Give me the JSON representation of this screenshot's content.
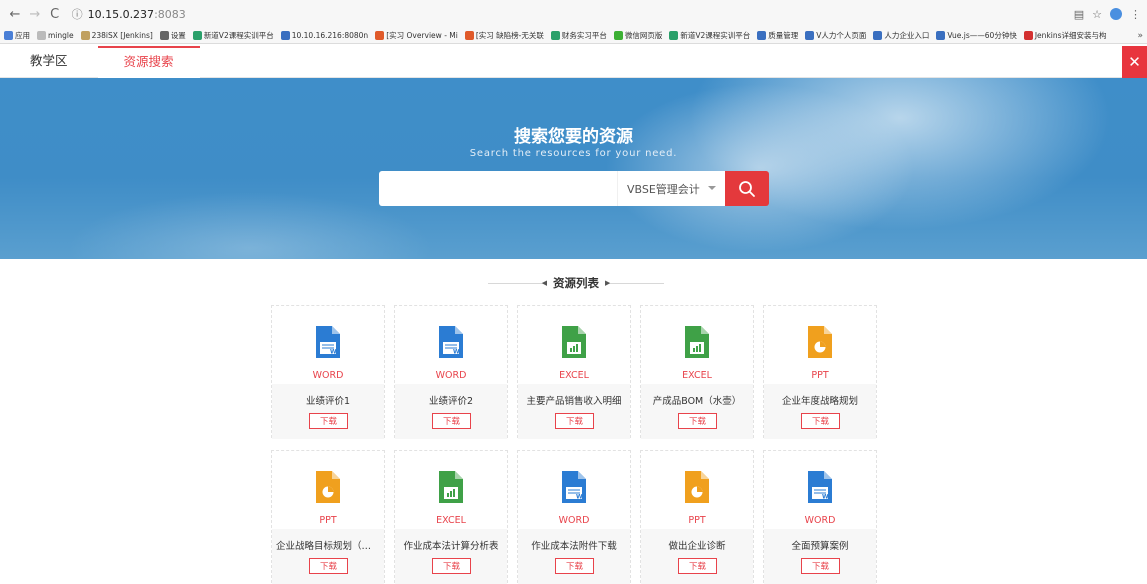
{
  "browser": {
    "url_host": "10.15.0.237",
    "url_port": ":8083",
    "bookmarks": [
      {
        "label": "应用",
        "color": "#4a7fd6"
      },
      {
        "label": "mingle",
        "color": "#bbbbbb"
      },
      {
        "label": "238iSX [Jenkins]",
        "color": "#c0a060"
      },
      {
        "label": "设置",
        "color": "#666666"
      },
      {
        "label": "新道V2课程实训平台",
        "color": "#2aa06a"
      },
      {
        "label": "10.10.16.216:8080n",
        "color": "#3a6fc0"
      },
      {
        "label": "[实习 Overview - Mi",
        "color": "#e05a2a"
      },
      {
        "label": "[实习 缺陷榜-无关联",
        "color": "#e05a2a"
      },
      {
        "label": "财务实习平台",
        "color": "#2aa06a"
      },
      {
        "label": "微信网页版",
        "color": "#3cb034"
      },
      {
        "label": "新道V2课程实训平台",
        "color": "#2aa06a"
      },
      {
        "label": "质量管理",
        "color": "#3a6fc0"
      },
      {
        "label": "V人力个人页面",
        "color": "#3a6fc0"
      },
      {
        "label": "人力企业入口",
        "color": "#3a6fc0"
      },
      {
        "label": "Vue.js——60分钟快",
        "color": "#3a6fc0"
      },
      {
        "label": "Jenkins详细安装与构",
        "color": "#d33030"
      }
    ],
    "more": "»"
  },
  "tabs": [
    {
      "label": "教学区",
      "active": false
    },
    {
      "label": "资源搜索",
      "active": true
    }
  ],
  "hero": {
    "title": "搜索您要的资源",
    "subtitle": "Search the resources for your need.",
    "search_placeholder": "",
    "select_value": "VBSE管理会计"
  },
  "section_title": "资源列表",
  "download_label": "下载",
  "resources": [
    {
      "type": "WORD",
      "name": "业绩评价1",
      "icon": "word-file-icon"
    },
    {
      "type": "WORD",
      "name": "业绩评价2",
      "icon": "word-file-icon"
    },
    {
      "type": "EXCEL",
      "name": "主要产品销售收入明细",
      "icon": "excel-file-icon"
    },
    {
      "type": "EXCEL",
      "name": "产成品BOM（水壶）",
      "icon": "excel-file-icon"
    },
    {
      "type": "PPT",
      "name": "企业年度战略规划",
      "icon": "ppt-file-icon"
    },
    {
      "type": "PPT",
      "name": "企业战略目标规划（销...",
      "icon": "ppt-file-icon"
    },
    {
      "type": "EXCEL",
      "name": "作业成本法计算分析表",
      "icon": "excel-file-icon"
    },
    {
      "type": "WORD",
      "name": "作业成本法附件下载",
      "icon": "word-file-icon"
    },
    {
      "type": "PPT",
      "name": "做出企业诊断",
      "icon": "ppt-file-icon"
    },
    {
      "type": "WORD",
      "name": "全面预算案例",
      "icon": "word-file-icon"
    }
  ],
  "colors": {
    "accent": "#e8434b",
    "word": "#2b7cd3",
    "excel": "#3fa147",
    "ppt": "#f0a01e"
  }
}
